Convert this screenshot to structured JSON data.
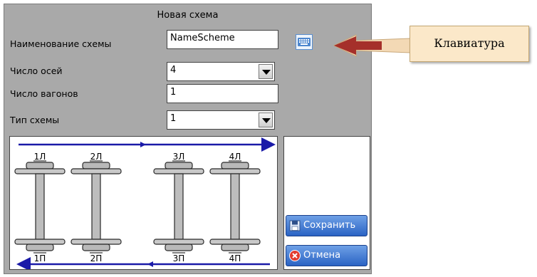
{
  "dialog": {
    "title": "Новая схема",
    "fields": {
      "name_label": "Наименование схемы",
      "name_value": "NameScheme",
      "axles_label": "Число осей",
      "axles_value": "4",
      "wagons_label": "Число вагонов",
      "wagons_value": "1",
      "type_label": "Тип схемы",
      "type_value": "1"
    },
    "keyboard_icon": "keyboard-icon",
    "scheme": {
      "top_labels": [
        "1Л",
        "2Л",
        "3Л",
        "4Л"
      ],
      "bottom_labels": [
        "1П",
        "2П",
        "3П",
        "4П"
      ]
    },
    "buttons": {
      "save_label": "Сохранить",
      "save_icon": "floppy-disk-icon",
      "cancel_label": "Отмена",
      "cancel_icon": "cancel-x-icon"
    }
  },
  "callout": {
    "text": "Клавиатура"
  },
  "colors": {
    "dialog_bg": "#a9a9a9",
    "button_blue": "#3a73d4",
    "arrow_blue": "#1a1aa8",
    "callout_bg": "#fbe8c9",
    "pointer_red": "#a5302a"
  }
}
